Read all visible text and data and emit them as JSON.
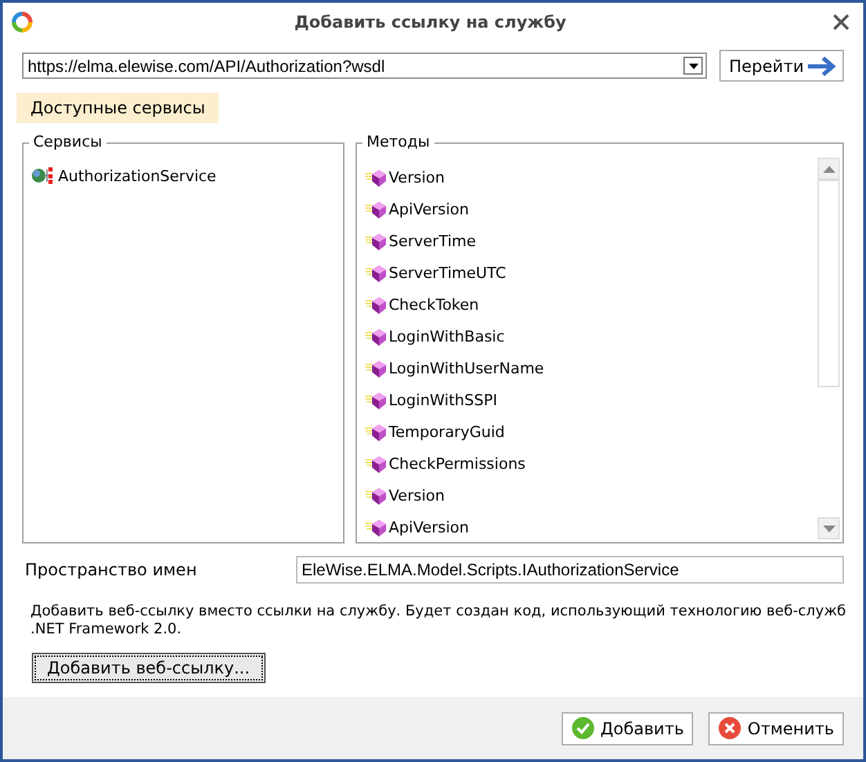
{
  "window": {
    "title": "Добавить ссылку на службу"
  },
  "address": {
    "value": "https://elma.elewise.com/API/Authorization?wsdl",
    "go_button": "Перейти"
  },
  "tabs": [
    {
      "label": "Доступные сервисы",
      "selected": true
    }
  ],
  "services": {
    "title": "Сервисы",
    "items": [
      {
        "label": "AuthorizationService"
      }
    ]
  },
  "methods": {
    "title": "Методы",
    "items": [
      {
        "label": "Version"
      },
      {
        "label": "ApiVersion"
      },
      {
        "label": "ServerTime"
      },
      {
        "label": "ServerTimeUTC"
      },
      {
        "label": "CheckToken"
      },
      {
        "label": "LoginWithBasic"
      },
      {
        "label": "LoginWithUserName"
      },
      {
        "label": "LoginWithSSPI"
      },
      {
        "label": "TemporaryGuid"
      },
      {
        "label": "CheckPermissions"
      },
      {
        "label": "Version"
      },
      {
        "label": "ApiVersion"
      }
    ]
  },
  "namespace": {
    "label": "Пространство имен",
    "value": "EleWise.ELMA.Model.Scripts.IAuthorizationService"
  },
  "web_reference": {
    "description": "Добавить веб-ссылку вместо ссылки на службу. Будет создан код, использующий технологию веб-служб .NET Framework 2.0.",
    "button": "Добавить веб-ссылку..."
  },
  "buttons": [
    {
      "label": "Добавить",
      "kind": "ok"
    },
    {
      "label": "Отменить",
      "kind": "cancel"
    }
  ]
}
